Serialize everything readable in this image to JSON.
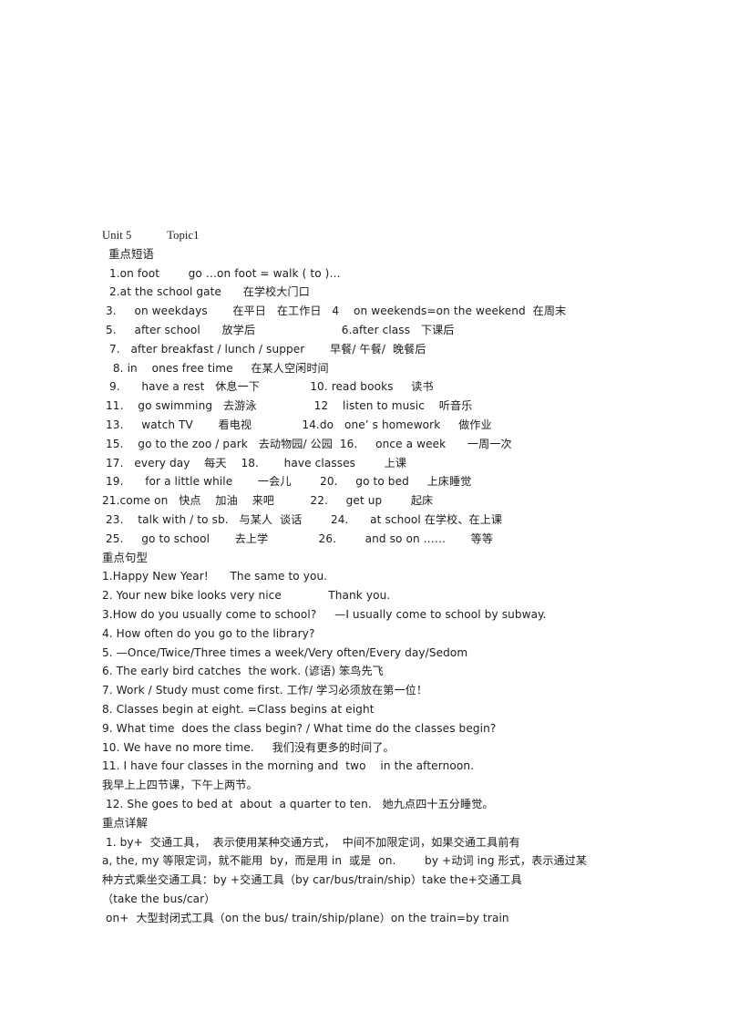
{
  "document": {
    "title_line": {
      "unit": "Unit 5",
      "topic": "Topic1",
      "full": "Unit 5            Topic1"
    },
    "sections": [
      {
        "heading": "重点短语",
        "lines": [
          " 1.on foot        go …on foot = walk ( to )…",
          " 2.at the school gate      在学校大门口",
          "3.     on weekdays       在平日   在工作日   4    on weekends=on the weekend  在周末",
          "5.     after school      放学后                        6.after class   下课后",
          " 7.   after breakfast / lunch / supper       早餐/ 午餐/  晚餐后",
          "  8. in    ones free time     在某人空闲时间",
          " 9.      have a rest   休息一下              10. read books     读书",
          "11.    go swimming   去游泳                12    listen to music    听音乐",
          "13.     watch TV       看电视              14.do   one’ s homework     做作业",
          "15.    go to the zoo / park   去动物园/ 公园  16.     once a week      一周一次",
          "17.   every day    每天    18.       have classes        上课",
          "19.      for a little while       一会儿        20.     go to bed     上床睡觉",
          "21.come on   快点    加油    来吧          22.     get up        起床",
          "23.    talk with / to sb.   与某人  谈话        24.      at school 在学校、在上课",
          "25.     go to school       去上学              26.        and so on ……       等等"
        ]
      },
      {
        "heading": "重点句型",
        "lines": [
          "1.Happy New Year!      The same to you.",
          "2. Your new bike looks very nice             Thank you.",
          "3.How do you usually come to school?     —I usually come to school by subway.",
          "4. How often do you go to the library?",
          "5. —Once/Twice/Three times a week/Very often/Every day/Sedom",
          "6. The early bird catches  the work. (谚语) 笨鸟先飞",
          "7. Work / Study must come first. 工作/ 学习必须放在第一位！",
          "8. Classes begin at eight. =Class begins at eight",
          "9. What time  does the class begin? / What time do the classes begin?",
          "10. We have no more time.     我们没有更多的时间了。",
          "11. I have four classes in the morning and  two    in the afternoon.",
          "我早上上四节课，下午上两节。",
          " 12. She goes to bed at  about  a quarter to ten.   她九点四十五分睡觉。"
        ]
      },
      {
        "heading": "重点详解",
        "lines": [
          " 1. by+  交通工具，  表示使用某种交通方式，  中间不加限定词，如果交通工具前有",
          "a, the, my 等限定词，就不能用  by，而是用 in  或是  on.        by +动词 ing 形式，表示通过某",
          "种方式乘坐交通工具：by +交通工具（by car/bus/train/ship）take the+交通工具",
          "（take the bus/car）",
          " on+  大型封闭式工具（on the bus/ train/ship/plane）on the train=by train"
        ]
      }
    ]
  }
}
